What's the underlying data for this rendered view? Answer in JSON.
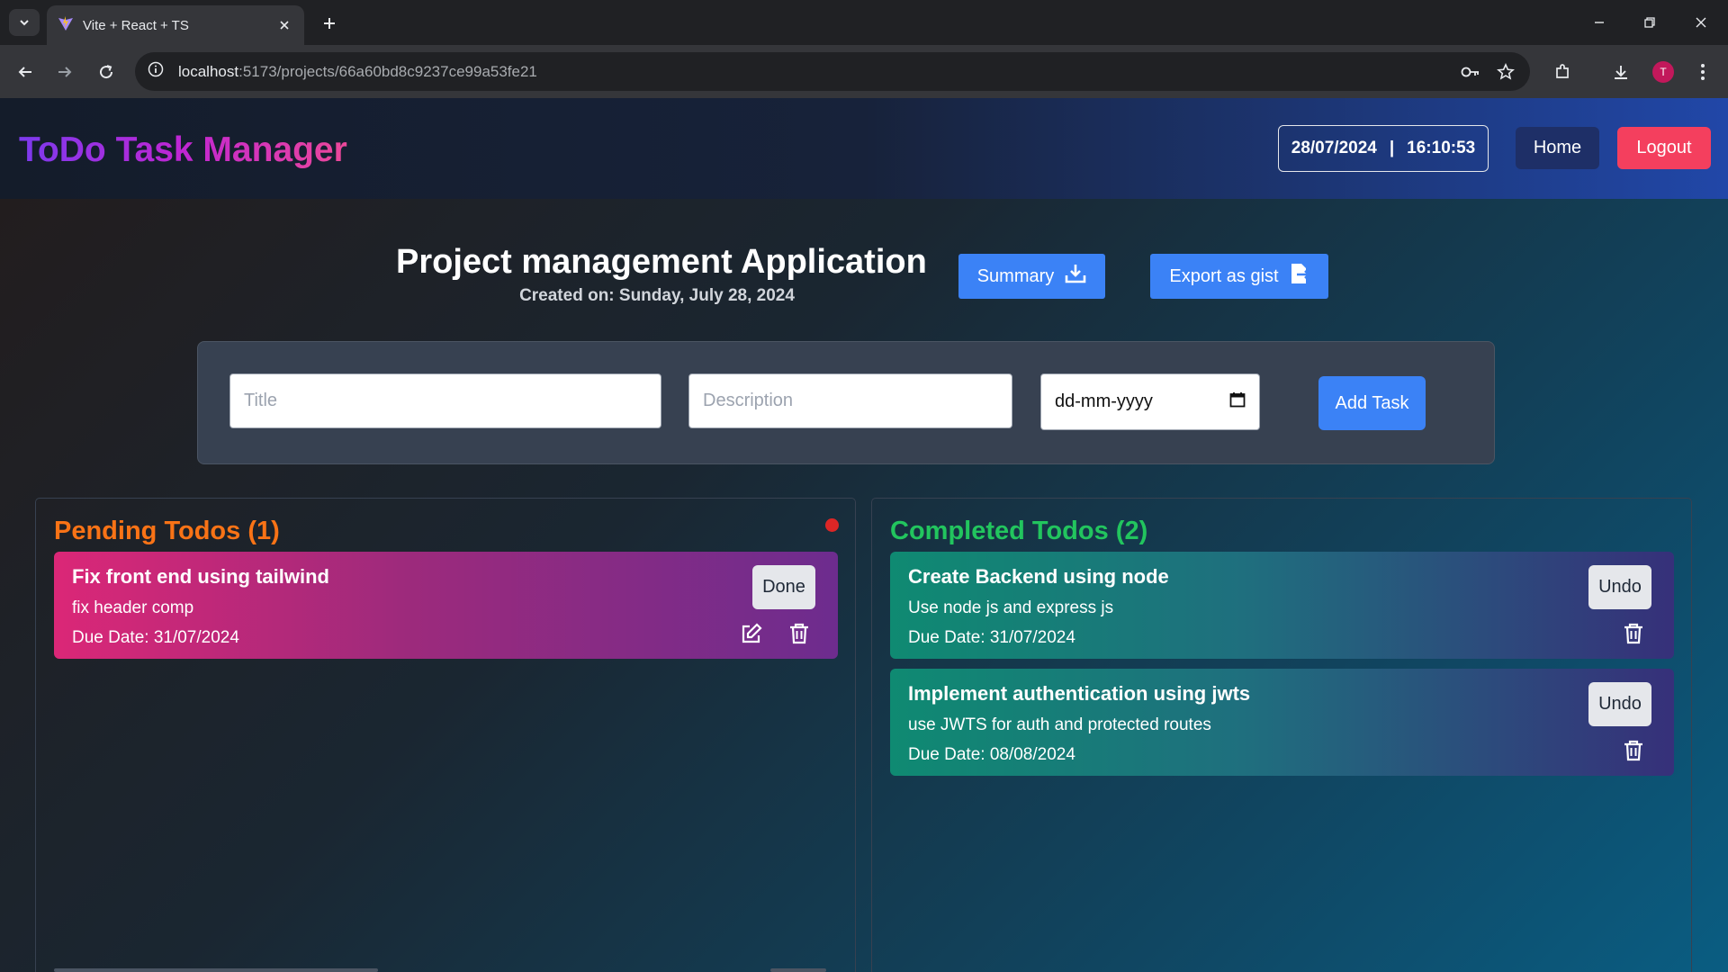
{
  "browser": {
    "tab_title": "Vite + React + TS",
    "url_host": "localhost",
    "url_rest": ":5173/projects/66a60bd8c9237ce99a53fe21",
    "profile_initial": "T"
  },
  "header": {
    "brand": "ToDo Task Manager",
    "date": "28/07/2024",
    "separator": "|",
    "time": "16:10:53",
    "home_label": "Home",
    "logout_label": "Logout"
  },
  "project": {
    "title": "Project management Application",
    "created": "Created on: Sunday, July 28, 2024",
    "summary_label": "Summary",
    "export_label": "Export as gist"
  },
  "form": {
    "title_placeholder": "Title",
    "description_placeholder": "Description",
    "date_placeholder": "dd-mm-yyyy",
    "add_label": "Add Task"
  },
  "pending": {
    "heading": "Pending Todos (1)",
    "items": [
      {
        "title": "Fix front end using tailwind",
        "description": "fix header comp",
        "due": "Due Date: 31/07/2024",
        "action": "Done"
      }
    ]
  },
  "completed": {
    "heading": "Completed Todos (2)",
    "items": [
      {
        "title": "Create Backend using node",
        "description": "Use node js and express js",
        "due": "Due Date: 31/07/2024",
        "action": "Undo"
      },
      {
        "title": "Implement authentication using jwts",
        "description": "use JWTS for auth and protected routes",
        "due": "Due Date: 08/08/2024",
        "action": "Undo"
      }
    ]
  },
  "colors": {
    "accent_blue": "#3b82f6",
    "logout_red": "#f43f5e",
    "pending_orange": "#f97316",
    "completed_green": "#22c55e"
  }
}
